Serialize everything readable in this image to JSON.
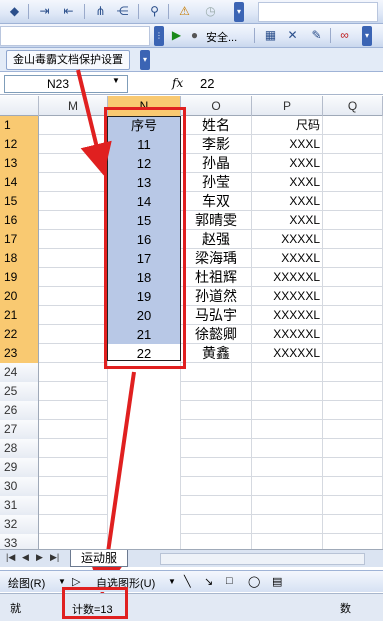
{
  "toolbar_security": {
    "label": "安全..."
  },
  "addin_bar": {
    "label": "金山毒霸文档保护设置"
  },
  "formula_bar": {
    "name_box": "N23",
    "fx_label": "fx",
    "formula_value": "22"
  },
  "columns": [
    {
      "id": "M",
      "label": "M",
      "selected": false
    },
    {
      "id": "N",
      "label": "N",
      "selected": true
    },
    {
      "id": "O",
      "label": "O",
      "selected": false
    },
    {
      "id": "P",
      "label": "P",
      "selected": false
    },
    {
      "id": "Q",
      "label": "Q",
      "selected": false
    }
  ],
  "rows": [
    {
      "num": "1",
      "n": "序号",
      "o": "姓名",
      "p": "尺码",
      "hl": true
    },
    {
      "num": "12",
      "n": "11",
      "o": "李影",
      "p": "XXXL",
      "hl": true
    },
    {
      "num": "13",
      "n": "12",
      "o": "孙晶",
      "p": "XXXL",
      "hl": true
    },
    {
      "num": "14",
      "n": "13",
      "o": "孙莹",
      "p": "XXXL",
      "hl": true
    },
    {
      "num": "15",
      "n": "14",
      "o": "车双",
      "p": "XXXL",
      "hl": true
    },
    {
      "num": "16",
      "n": "15",
      "o": "郭晴雯",
      "p": "XXXL",
      "hl": true
    },
    {
      "num": "17",
      "n": "16",
      "o": "赵强",
      "p": "XXXXL",
      "hl": true
    },
    {
      "num": "18",
      "n": "17",
      "o": "梁海瑀",
      "p": "XXXXL",
      "hl": true
    },
    {
      "num": "19",
      "n": "18",
      "o": "杜祖辉",
      "p": "XXXXXL",
      "hl": true
    },
    {
      "num": "20",
      "n": "19",
      "o": "孙道然",
      "p": "XXXXXL",
      "hl": true
    },
    {
      "num": "21",
      "n": "20",
      "o": "马弘宇",
      "p": "XXXXXL",
      "hl": true
    },
    {
      "num": "22",
      "n": "21",
      "o": "徐懿卿",
      "p": "XXXXXL",
      "hl": true
    },
    {
      "num": "23",
      "n": "22",
      "o": "黄鑫",
      "p": "XXXXXL",
      "hl": true
    },
    {
      "num": "24",
      "n": "",
      "o": "",
      "p": "",
      "hl": false
    },
    {
      "num": "25",
      "n": "",
      "o": "",
      "p": "",
      "hl": false
    },
    {
      "num": "26",
      "n": "",
      "o": "",
      "p": "",
      "hl": false
    },
    {
      "num": "27",
      "n": "",
      "o": "",
      "p": "",
      "hl": false
    },
    {
      "num": "28",
      "n": "",
      "o": "",
      "p": "",
      "hl": false
    },
    {
      "num": "29",
      "n": "",
      "o": "",
      "p": "",
      "hl": false
    },
    {
      "num": "30",
      "n": "",
      "o": "",
      "p": "",
      "hl": false
    },
    {
      "num": "31",
      "n": "",
      "o": "",
      "p": "",
      "hl": false
    },
    {
      "num": "32",
      "n": "",
      "o": "",
      "p": "",
      "hl": false
    },
    {
      "num": "33",
      "n": "",
      "o": "",
      "p": "",
      "hl": false
    }
  ],
  "sheet_tab": {
    "label": "运动服"
  },
  "draw_toolbar": {
    "draw_label": "绘图(R)",
    "autoshape_label": "自选图形(U)"
  },
  "status_bar": {
    "ready": "就",
    "count": "计数=13",
    "num": "数"
  },
  "colors": {
    "selection_fill": "#b8c8e6",
    "header_highlight": "#f9c971",
    "annotation_red": "#e02020"
  }
}
